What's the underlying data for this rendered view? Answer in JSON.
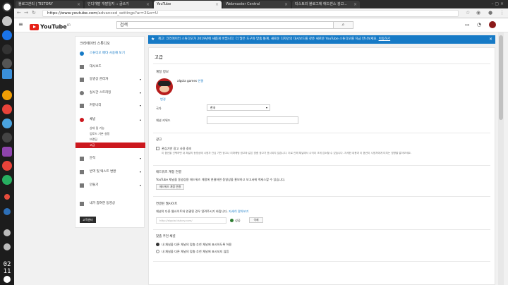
{
  "dock": {
    "clock_hour": "02",
    "clock_min": "11"
  },
  "tabs": [
    {
      "title": "블로그관리 | TISTORY"
    },
    {
      "title": "인디개발 개발일지 :: 글쓰기"
    },
    {
      "title": "YouTube"
    },
    {
      "title": "Webmaster Central"
    },
    {
      "title": "티스토리 블로그에 애드센스 광고..."
    }
  ],
  "address": {
    "prefix": "https://www.youtube.com",
    "path": "/advanced_settings?ar=2&o=U"
  },
  "youtube": {
    "logo_text": "YouTube",
    "logo_sup": "KR",
    "search_value": "검색"
  },
  "sidebar": {
    "title": "크리에이터 스튜디오",
    "beta": "스튜디오 베타 사용해 보기",
    "items": [
      {
        "label": "대시보드"
      },
      {
        "label": "동영상 관리자"
      },
      {
        "label": "실시간 스트리밍"
      },
      {
        "label": "커뮤니티"
      },
      {
        "label": "채널"
      }
    ],
    "subitems": [
      {
        "label": "상태 및 기능"
      },
      {
        "label": "업로드 기본 설정"
      },
      {
        "label": "브랜딩"
      },
      {
        "label": "고급"
      }
    ],
    "items2": [
      {
        "label": "분석"
      },
      {
        "label": "번역 및 텍스트 변환"
      },
      {
        "label": "만들기"
      },
      {
        "label": "내가 참여한 동영상"
      }
    ],
    "feedback": "고객센터"
  },
  "banner": {
    "text": "제고: 크리에이터 스튜디오가 2019년에 새롭게 바뀝니다. 더 많은 도구와 맞춤 통계, 새로운 디자인의 대시보드를 갖춘 새로운 YouTube 스튜디오를 지금 만나보세요.",
    "link": "이동하기"
  },
  "main": {
    "title": "고급",
    "account": {
      "heading": "계정 정보",
      "channel_name": "algoia games",
      "link": "연결",
      "change": "변경",
      "country_label": "국가",
      "country_value": "한국",
      "keywords_label": "채널 키워드"
    },
    "ads": {
      "heading": "광고",
      "checkbox_label": "관심기반 광고 사용 중지",
      "desc": "이 옵션을 선택하면 내 채널의 동영상에 시청자 관심 기반 광고나 리마케팅 광고와 같은 맞춤 광고가 표시되지 않습니다. 이로 인해 채널에서 수익이 크게 감소할 수 있습니다. 자세한 내용과 이 옵션이 시청자에게 미치는 영향을 알아보세요."
    },
    "adwords": {
      "heading": "애드워즈 계정 연결",
      "desc": "YouTube 채널을 동영상용 애드워즈 계정에 연결하면 동영상을 홍보하고 보고서에 액세스할 수 있습니다.",
      "button": "애드워즈 계정 연결"
    },
    "website": {
      "heading": "연결된 웹사이트",
      "desc": "채널의 다른 웹사이트와 연결된 경우 알려주시기 바랍니다.",
      "more": "자세히 알아보기",
      "url": "http://algoia.tistory.com/",
      "status": "성공",
      "remove": "삭제"
    },
    "recommend": {
      "heading": "맞춤 추천 채널",
      "opt1": "내 채널을 다른 채널의 맞춤 추천 채널에 표시하도록 허용",
      "opt2": "내 채널을 다른 채널의 맞춤 추천 채널에 표시되지 않음"
    }
  },
  "colors": {
    "youtube_red": "#e62117",
    "banner_blue": "#167ac6",
    "selected_red": "#cc181e"
  }
}
